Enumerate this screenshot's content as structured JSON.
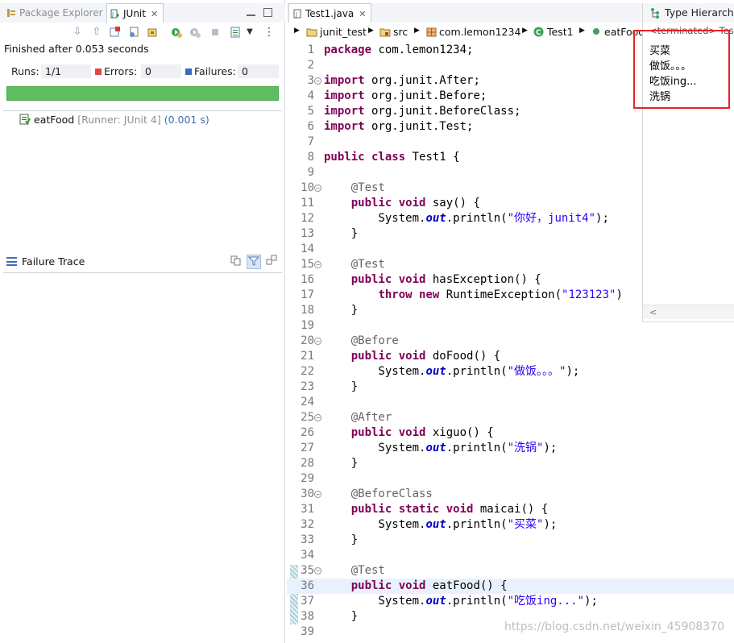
{
  "left_panel": {
    "tabs": {
      "package_explorer": "Package Explorer",
      "junit": "JUnit",
      "close": "✕"
    },
    "status": "Finished after 0.053 seconds",
    "runs_label": "Runs:",
    "runs_value": "1/1",
    "errors_label": "Errors:",
    "errors_value": "0",
    "failures_label": "Failures:",
    "failures_value": "0",
    "progress_fraction": 1.0,
    "progress_color": "#5ebd5e",
    "test": {
      "name": "eatFood",
      "runner": "[Runner: JUnit 4]",
      "time": "(0.001 s)"
    },
    "failure_trace_label": "Failure Trace"
  },
  "editor": {
    "tab_label": "Test1.java",
    "close": "✕",
    "breadcrumb": [
      "junit_test",
      "src",
      "com.lemon1234",
      "Test1",
      "eatFood"
    ],
    "lines": [
      {
        "n": "1",
        "parts": [
          {
            "t": "package",
            "c": "kw"
          },
          {
            "t": " com.lemon1234;"
          }
        ]
      },
      {
        "n": "2",
        "parts": []
      },
      {
        "n": "3",
        "fold": true,
        "parts": [
          {
            "t": "import",
            "c": "kw"
          },
          {
            "t": " org.junit.After;"
          }
        ]
      },
      {
        "n": "4",
        "parts": [
          {
            "t": "import",
            "c": "kw"
          },
          {
            "t": " org.junit.Before;"
          }
        ]
      },
      {
        "n": "5",
        "parts": [
          {
            "t": "import",
            "c": "kw"
          },
          {
            "t": " org.junit.BeforeClass;"
          }
        ]
      },
      {
        "n": "6",
        "parts": [
          {
            "t": "import",
            "c": "kw"
          },
          {
            "t": " org.junit.Test;"
          }
        ]
      },
      {
        "n": "7",
        "parts": []
      },
      {
        "n": "8",
        "parts": [
          {
            "t": "public class",
            "c": "kw"
          },
          {
            "t": " Test1 {"
          }
        ]
      },
      {
        "n": "9",
        "parts": []
      },
      {
        "n": "10",
        "fold": true,
        "parts": [
          {
            "t": "    "
          },
          {
            "t": "@Test",
            "c": "an"
          }
        ]
      },
      {
        "n": "11",
        "parts": [
          {
            "t": "    "
          },
          {
            "t": "public void",
            "c": "kw"
          },
          {
            "t": " say() {"
          }
        ]
      },
      {
        "n": "12",
        "parts": [
          {
            "t": "        System."
          },
          {
            "t": "out",
            "c": "fld"
          },
          {
            "t": ".println("
          },
          {
            "t": "\"你好，junit4\"",
            "c": "str"
          },
          {
            "t": ");"
          }
        ]
      },
      {
        "n": "13",
        "parts": [
          {
            "t": "    }"
          }
        ]
      },
      {
        "n": "14",
        "parts": []
      },
      {
        "n": "15",
        "fold": true,
        "parts": [
          {
            "t": "    "
          },
          {
            "t": "@Test",
            "c": "an"
          }
        ]
      },
      {
        "n": "16",
        "parts": [
          {
            "t": "    "
          },
          {
            "t": "public void",
            "c": "kw"
          },
          {
            "t": " hasException() {"
          }
        ]
      },
      {
        "n": "17",
        "parts": [
          {
            "t": "        "
          },
          {
            "t": "throw new",
            "c": "kw"
          },
          {
            "t": " RuntimeException("
          },
          {
            "t": "\"123123\"",
            "c": "str"
          },
          {
            "t": ")"
          }
        ]
      },
      {
        "n": "18",
        "parts": [
          {
            "t": "    }"
          }
        ]
      },
      {
        "n": "19",
        "parts": []
      },
      {
        "n": "20",
        "fold": true,
        "parts": [
          {
            "t": "    "
          },
          {
            "t": "@Before",
            "c": "an"
          }
        ]
      },
      {
        "n": "21",
        "parts": [
          {
            "t": "    "
          },
          {
            "t": "public void",
            "c": "kw"
          },
          {
            "t": " doFood() {"
          }
        ]
      },
      {
        "n": "22",
        "parts": [
          {
            "t": "        System."
          },
          {
            "t": "out",
            "c": "fld"
          },
          {
            "t": ".println("
          },
          {
            "t": "\"做饭。。。\"",
            "c": "str"
          },
          {
            "t": ");"
          }
        ]
      },
      {
        "n": "23",
        "parts": [
          {
            "t": "    }"
          }
        ]
      },
      {
        "n": "24",
        "parts": []
      },
      {
        "n": "25",
        "fold": true,
        "parts": [
          {
            "t": "    "
          },
          {
            "t": "@After",
            "c": "an"
          }
        ]
      },
      {
        "n": "26",
        "parts": [
          {
            "t": "    "
          },
          {
            "t": "public void",
            "c": "kw"
          },
          {
            "t": " xiguo() {"
          }
        ]
      },
      {
        "n": "27",
        "parts": [
          {
            "t": "        System."
          },
          {
            "t": "out",
            "c": "fld"
          },
          {
            "t": ".println("
          },
          {
            "t": "\"洗锅\"",
            "c": "str"
          },
          {
            "t": ");"
          }
        ]
      },
      {
        "n": "28",
        "parts": [
          {
            "t": "    }"
          }
        ]
      },
      {
        "n": "29",
        "parts": []
      },
      {
        "n": "30",
        "fold": true,
        "parts": [
          {
            "t": "    "
          },
          {
            "t": "@BeforeClass",
            "c": "an"
          }
        ]
      },
      {
        "n": "31",
        "parts": [
          {
            "t": "    "
          },
          {
            "t": "public static void",
            "c": "kw"
          },
          {
            "t": " maicai() {"
          }
        ]
      },
      {
        "n": "32",
        "parts": [
          {
            "t": "        System."
          },
          {
            "t": "out",
            "c": "fld"
          },
          {
            "t": ".println("
          },
          {
            "t": "\"买菜\"",
            "c": "str"
          },
          {
            "t": ");"
          }
        ]
      },
      {
        "n": "33",
        "parts": [
          {
            "t": "    }"
          }
        ]
      },
      {
        "n": "34",
        "parts": []
      },
      {
        "n": "35",
        "fold": true,
        "parts": [
          {
            "t": "    "
          },
          {
            "t": "@Test",
            "c": "an"
          }
        ]
      },
      {
        "n": "36",
        "current": true,
        "parts": [
          {
            "t": "    "
          },
          {
            "t": "public void",
            "c": "kw"
          },
          {
            "t": " eatFood() {"
          }
        ]
      },
      {
        "n": "37",
        "parts": [
          {
            "t": "        System."
          },
          {
            "t": "out",
            "c": "fld"
          },
          {
            "t": ".println("
          },
          {
            "t": "\"吃饭ing...\"",
            "c": "str"
          },
          {
            "t": ");"
          }
        ]
      },
      {
        "n": "38",
        "parts": [
          {
            "t": "    }"
          }
        ]
      },
      {
        "n": "39",
        "parts": []
      }
    ]
  },
  "type_hierarchy": {
    "tab_label": "Type Hierarchy",
    "terminated": "<terminated> Test",
    "output": [
      "买菜",
      "做饭。。。",
      "吃饭ing...",
      "洗锅"
    ],
    "scroll_arrow": "<"
  },
  "watermark": "https://blog.csdn.net/weixin_45908370",
  "colors": {
    "keyword": "#7f0055",
    "string": "#2a00ff",
    "annotation": "#646464",
    "highlight_box": "#e82323"
  }
}
